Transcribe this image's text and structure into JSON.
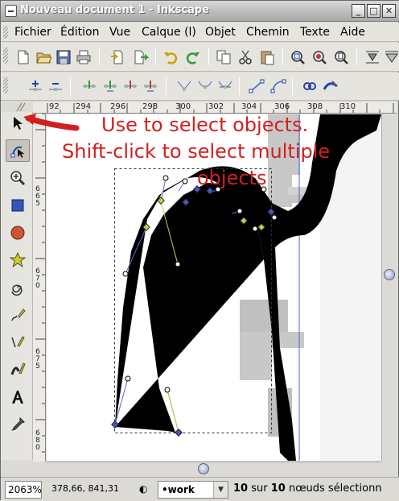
{
  "window": {
    "title": "Nouveau document 1 - Inkscape",
    "buttons": {
      "minimize": "_",
      "maximize": "□",
      "close": "✕"
    }
  },
  "menu": {
    "items": [
      "Fichier",
      "Édition",
      "Vue",
      "Calque (l)",
      "Objet",
      "Chemin",
      "Texte",
      "Aide"
    ]
  },
  "toolbar_commands": {
    "icons": [
      "new-icon",
      "open-icon",
      "save-icon",
      "print-icon",
      "import-icon",
      "export-icon",
      "undo-icon",
      "redo-icon",
      "copy-icon",
      "cut-icon",
      "paste-icon",
      "zoom-selection-icon",
      "zoom-drawing-icon",
      "zoom-page-icon",
      "align-icon",
      "distribute-icon"
    ]
  },
  "toolbar_nodes": {
    "icons": [
      "insert-node-icon",
      "delete-node-icon",
      "join-nodes-icon",
      "break-path-icon",
      "join-segment-icon",
      "delete-segment-icon",
      "cusp-node-icon",
      "smooth-node-icon",
      "symmetric-node-icon",
      "line-segment-icon",
      "curve-segment-icon",
      "stroke-to-path-icon",
      "object-to-path-icon"
    ]
  },
  "ruler": {
    "h_labels": [
      "92",
      "294",
      "296",
      "298",
      "300",
      "302",
      "304",
      "306",
      "308",
      "310"
    ],
    "v_labels": [
      "665",
      "670",
      "675",
      "680"
    ]
  },
  "tools": {
    "items": [
      "selector-icon",
      "node-editor-icon",
      "zoom-icon",
      "rectangle-icon",
      "ellipse-icon",
      "star-icon",
      "spiral-icon",
      "pencil-icon",
      "pen-icon",
      "calligraphy-icon",
      "text-icon",
      "dropper-icon"
    ],
    "active": "node-editor-icon"
  },
  "annotation": {
    "line1": "Use to select objects.",
    "line2": "Shift-click to select multiple",
    "line3": "objects",
    "color": "#d31f1f"
  },
  "status": {
    "zoom": "2063%",
    "coords": "378,66, 841,31",
    "layer": "•work",
    "selected_count": "10",
    "sur": "sur",
    "total_count": "10",
    "message_suffix": "nœuds sélectionn"
  }
}
